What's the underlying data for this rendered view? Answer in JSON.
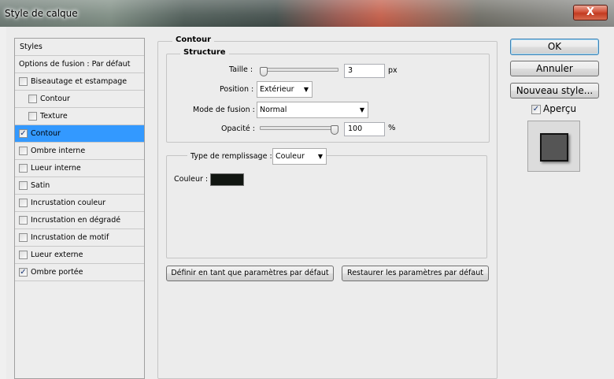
{
  "window": {
    "title": "Style de calque",
    "close_label": "X"
  },
  "styles_list": {
    "header": "Styles",
    "blend_options": "Options de fusion : Par défaut",
    "items": [
      {
        "label": "Biseautage et estampage",
        "checked": false,
        "indent": false,
        "selected": false
      },
      {
        "label": "Contour",
        "checked": false,
        "indent": true,
        "selected": false
      },
      {
        "label": "Texture",
        "checked": false,
        "indent": true,
        "selected": false
      },
      {
        "label": "Contour",
        "checked": true,
        "indent": false,
        "selected": true
      },
      {
        "label": "Ombre interne",
        "checked": false,
        "indent": false,
        "selected": false
      },
      {
        "label": "Lueur interne",
        "checked": false,
        "indent": false,
        "selected": false
      },
      {
        "label": "Satin",
        "checked": false,
        "indent": false,
        "selected": false
      },
      {
        "label": "Incrustation couleur",
        "checked": false,
        "indent": false,
        "selected": false
      },
      {
        "label": "Incrustation en dégradé",
        "checked": false,
        "indent": false,
        "selected": false
      },
      {
        "label": "Incrustation de motif",
        "checked": false,
        "indent": false,
        "selected": false
      },
      {
        "label": "Lueur externe",
        "checked": false,
        "indent": false,
        "selected": false
      },
      {
        "label": "Ombre portée",
        "checked": true,
        "indent": false,
        "selected": false
      }
    ]
  },
  "contour": {
    "title": "Contour",
    "structure_title": "Structure",
    "size_label": "Taille :",
    "size_value": "3",
    "size_unit": "px",
    "size_slider": 0.02,
    "position_label": "Position :",
    "position_value": "Extérieur",
    "blend_label": "Mode de fusion :",
    "blend_value": "Normal",
    "opacity_label": "Opacité :",
    "opacity_value": "100",
    "opacity_unit": "%",
    "opacity_slider": 1.0,
    "fill_type_label": "Type de remplissage :",
    "fill_type_value": "Couleur",
    "color_label": "Couleur :",
    "color_hex": "#111611",
    "set_default_btn": "Définir en tant que paramètres par défaut",
    "reset_default_btn": "Restaurer les paramètres par défaut"
  },
  "buttons": {
    "ok": "OK",
    "cancel": "Annuler",
    "new_style": "Nouveau style...",
    "preview_label": "Aperçu",
    "preview_checked": true
  }
}
